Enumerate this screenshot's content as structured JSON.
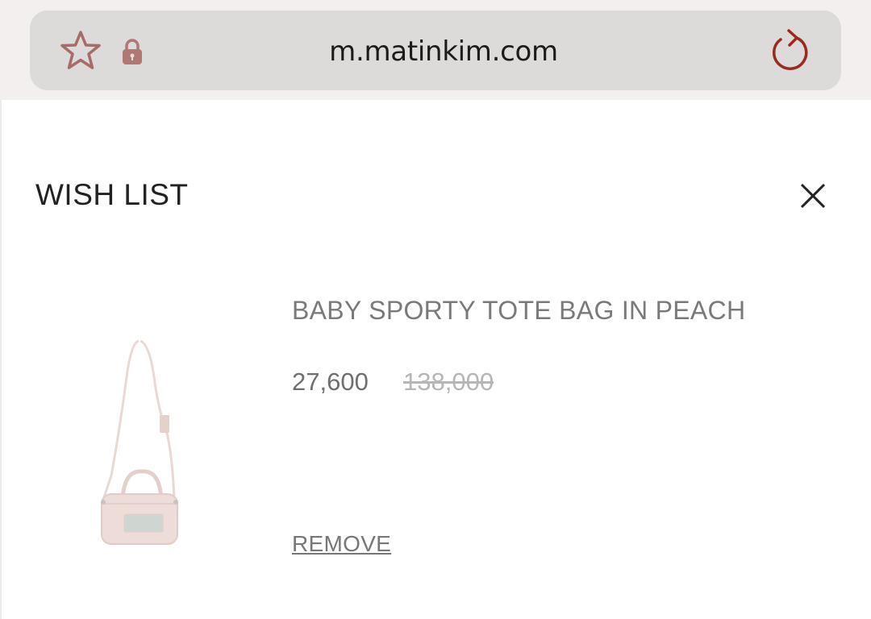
{
  "browser": {
    "url": "m.matinkim.com",
    "icons": {
      "bookmark": "star-icon",
      "secure": "lock-icon",
      "reload": "reload-icon"
    },
    "accent_color": "#a06862",
    "reload_color": "#9a2a1e"
  },
  "wishlist": {
    "title": "WISH LIST",
    "close_icon": "close-icon",
    "items": [
      {
        "name": "BABY SPORTY TOTE BAG IN PEACH",
        "price": "27,600",
        "original_price": "138,000",
        "remove_label": "REMOVE",
        "image_color": "#eedcd8"
      }
    ]
  }
}
